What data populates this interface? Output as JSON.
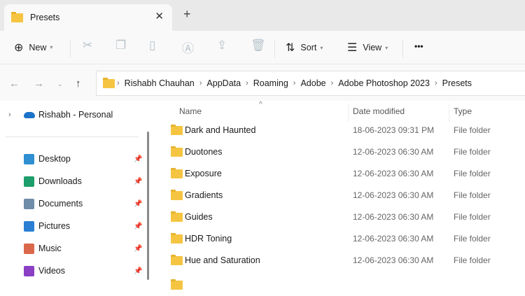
{
  "tab": {
    "title": "Presets",
    "close": "✕",
    "new_tab": "+"
  },
  "toolbar": {
    "new_label": "New",
    "sort_label": "Sort",
    "view_label": "View",
    "more": "•••"
  },
  "breadcrumb": [
    "Rishabh Chauhan",
    "AppData",
    "Roaming",
    "Adobe",
    "Adobe Photoshop 2023",
    "Presets"
  ],
  "sidebar": {
    "cloud": "Rishabh - Personal",
    "items": [
      {
        "label": "Desktop",
        "color": "#2f8fd1"
      },
      {
        "label": "Downloads",
        "color": "#1e9e6b"
      },
      {
        "label": "Documents",
        "color": "#6f8ca8"
      },
      {
        "label": "Pictures",
        "color": "#2a7fd4"
      },
      {
        "label": "Music",
        "color": "#d9694a"
      },
      {
        "label": "Videos",
        "color": "#8a3fc4"
      }
    ]
  },
  "columns": {
    "name": "Name",
    "date": "Date modified",
    "type": "Type"
  },
  "files": [
    {
      "name": "Dark and Haunted",
      "date": "18-06-2023 09:31 PM",
      "type": "File folder"
    },
    {
      "name": "Duotones",
      "date": "12-06-2023 06:30 AM",
      "type": "File folder"
    },
    {
      "name": "Exposure",
      "date": "12-06-2023 06:30 AM",
      "type": "File folder"
    },
    {
      "name": "Gradients",
      "date": "12-06-2023 06:30 AM",
      "type": "File folder"
    },
    {
      "name": "Guides",
      "date": "12-06-2023 06:30 AM",
      "type": "File folder"
    },
    {
      "name": "HDR Toning",
      "date": "12-06-2023 06:30 AM",
      "type": "File folder"
    },
    {
      "name": "Hue and Saturation",
      "date": "12-06-2023 06:30 AM",
      "type": "File folder"
    }
  ]
}
